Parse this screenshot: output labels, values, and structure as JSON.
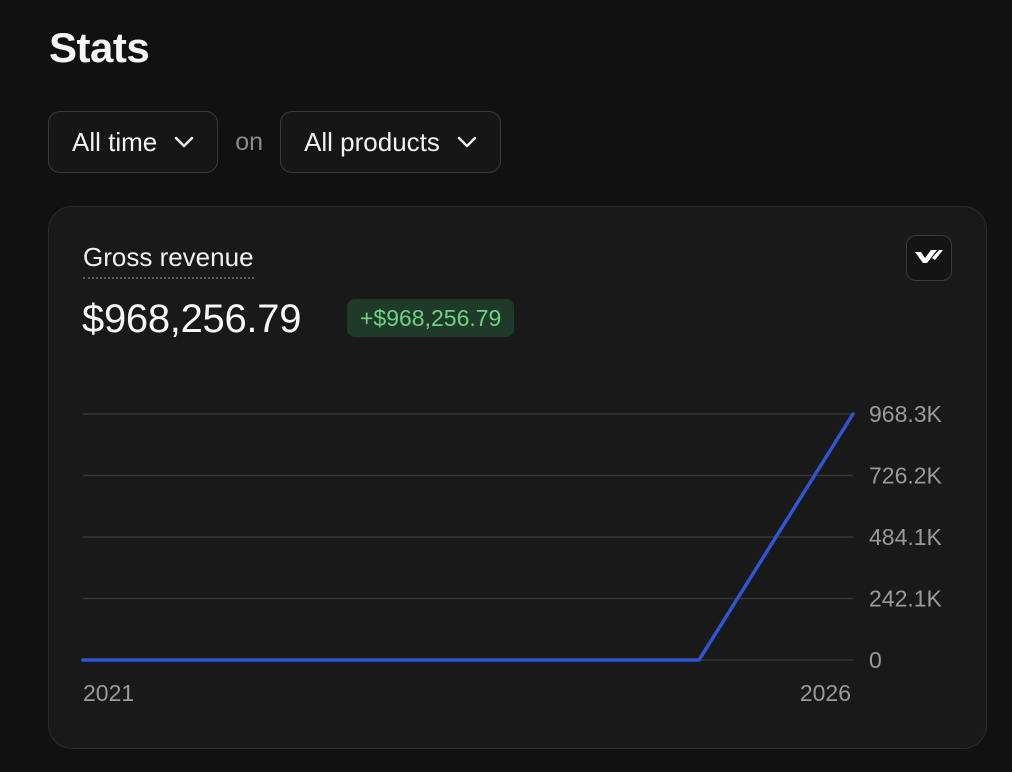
{
  "page": {
    "title": "Stats"
  },
  "filters": {
    "time_range": "All time",
    "connector": "on",
    "product": "All products"
  },
  "card": {
    "metric_label": "Gross revenue",
    "metric_value": "$968,256.79",
    "change": "+$968,256.79",
    "logo_icon": "brand-logo-icon"
  },
  "colors": {
    "line": "#2f55d4",
    "badge_bg": "#1f3a28",
    "badge_text": "#6fd184",
    "background": "#111111",
    "card": "#191919"
  },
  "chart_data": {
    "type": "line",
    "x": [
      "2021",
      "2022",
      "2023",
      "2024",
      "2025",
      "2026"
    ],
    "x_tick_labels": [
      "2021",
      "2026"
    ],
    "series": [
      {
        "values": [
          0,
          0,
          0,
          0,
          0,
          968256.79
        ]
      }
    ],
    "y_tick_labels": [
      "968.3K",
      "726.2K",
      "484.1K",
      "242.1K",
      "0"
    ],
    "y_ticks": [
      968256.79,
      726192.59,
      484128.4,
      242064.2,
      0
    ],
    "ylim": [
      0,
      968256.79
    ],
    "y_axis_position": "right",
    "grid": true
  }
}
